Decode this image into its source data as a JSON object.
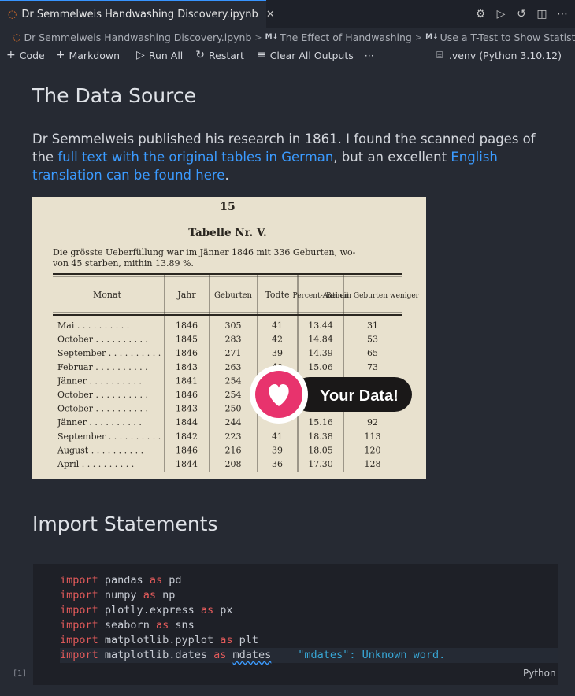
{
  "tab": {
    "title": "Dr Semmelweis Handwashing Discovery.ipynb",
    "close_icon": "close-icon"
  },
  "actions": [
    "settings-gear-icon",
    "run-icon",
    "history-icon",
    "split-editor-icon",
    "more-icon"
  ],
  "breadcrumb": {
    "file": "Dr Semmelweis Handwashing Discovery.ipynb",
    "section1": "The Effect of Handwashing",
    "section2": "Use a T-Test to Show Statistica",
    "badge": "M↓"
  },
  "toolbar": {
    "code": "Code",
    "markdown": "Markdown",
    "run_all": "Run All",
    "restart": "Restart",
    "clear_all": "Clear All Outputs",
    "more": "···",
    "kernel": ".venv (Python 3.10.12)"
  },
  "cells": {
    "heading1": "The Data Source",
    "para": {
      "t1": "Dr Semmelweis published his research in 1861. I found the scanned pages of the ",
      "link1": "full text with the original tables in German",
      "t2": ", but an excellent ",
      "link2": "English translation can be found here",
      "t3": "."
    },
    "scan": {
      "page": "15",
      "title": "Tabelle Nr. V.",
      "caption1": "Die grösste Ueberfüllung war im Jänner 1846 mit 336 Geburten, wo-",
      "caption2": "von 45 starben, mithin 13.89 %.",
      "headers": [
        "Monat",
        "Jahr",
        "Geburten",
        "Todte",
        "Percent-Antheil",
        "Bei um Geburten weniger"
      ],
      "rows": [
        [
          "Mai",
          "1846",
          "305",
          "41",
          "13.44",
          "31"
        ],
        [
          "October",
          "1845",
          "283",
          "42",
          "14.84",
          "53"
        ],
        [
          "September",
          "1846",
          "271",
          "39",
          "14.39",
          "65"
        ],
        [
          "Februar",
          "1843",
          "263",
          "40",
          "15.06",
          "73"
        ],
        [
          "Jänner",
          "1841",
          "254",
          "",
          "",
          ""
        ],
        [
          "October",
          "1846",
          "254",
          "",
          "",
          ""
        ],
        [
          "October",
          "1843",
          "250",
          "",
          "17.",
          ""
        ],
        [
          "Jänner",
          "1844",
          "244",
          "",
          "15.16",
          "92"
        ],
        [
          "September",
          "1842",
          "223",
          "41",
          "18.38",
          "113"
        ],
        [
          "August",
          "1846",
          "216",
          "39",
          "18.05",
          "120"
        ],
        [
          "April",
          "1844",
          "208",
          "36",
          "17.30",
          "128"
        ]
      ],
      "badge": "Your Data!"
    },
    "heading2": "Import Statements",
    "code": [
      {
        "kw": "import",
        "mod": "pandas",
        "as": "as",
        "alias": "pd"
      },
      {
        "kw": "import",
        "mod": "numpy",
        "as": "as",
        "alias": "np"
      },
      {
        "kw": "import",
        "mod": "plotly.express",
        "as": "as",
        "alias": "px"
      },
      {
        "kw": "import",
        "mod": "seaborn",
        "as": "as",
        "alias": "sns"
      },
      {
        "kw": "import",
        "mod": "matplotlib.pyplot",
        "as": "as",
        "alias": "plt"
      },
      {
        "kw": "import",
        "mod": "matplotlib.dates",
        "as": "as",
        "alias": "mdates"
      }
    ],
    "hint": "\"mdates\": Unknown word.",
    "exec_count": "[1]",
    "language": "Python"
  }
}
